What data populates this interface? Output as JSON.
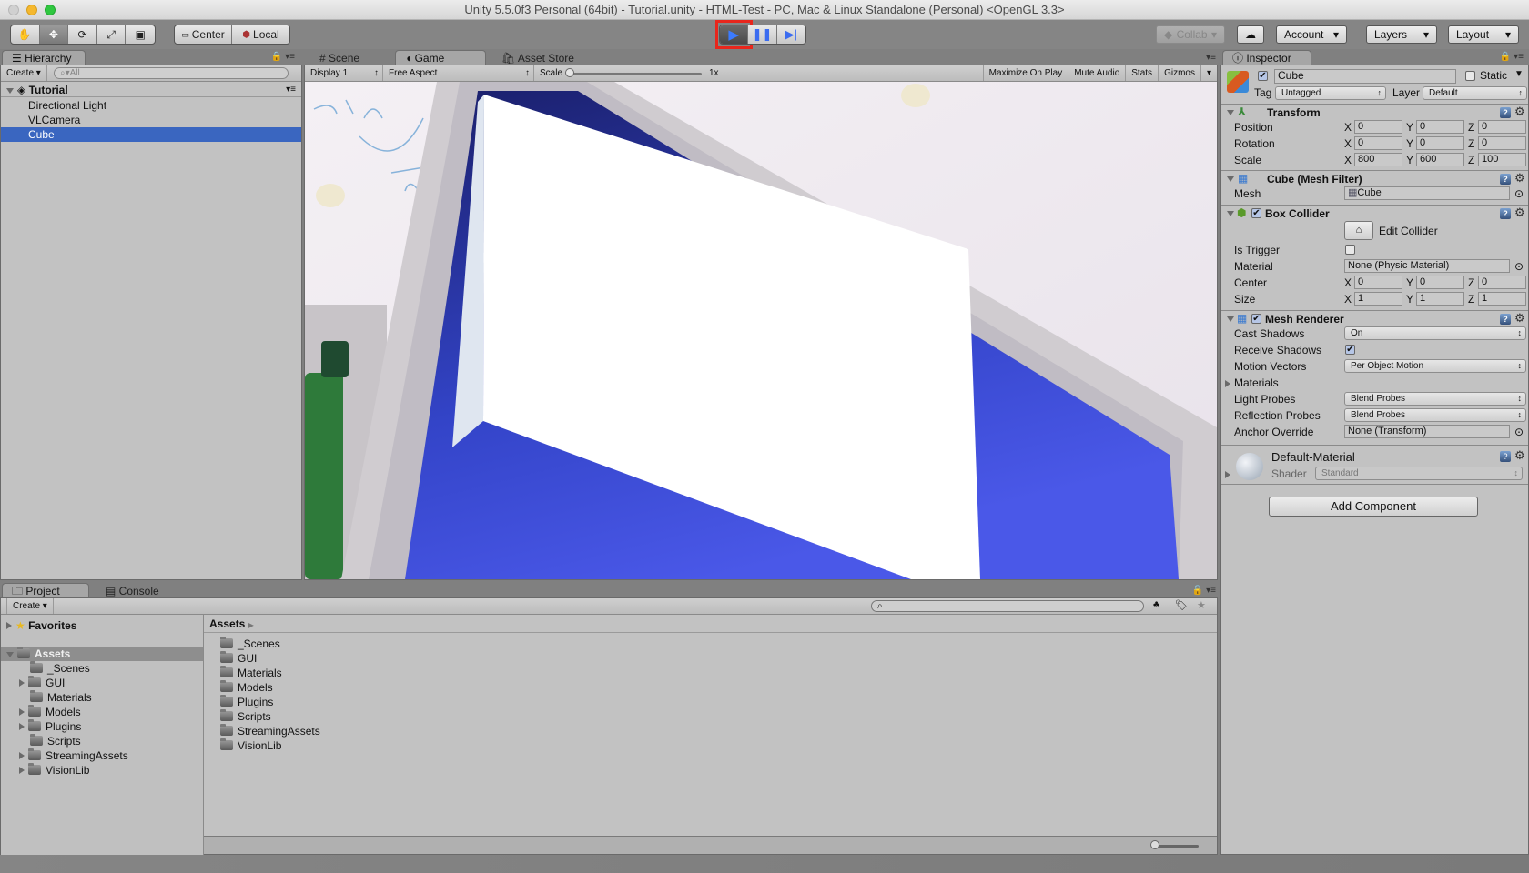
{
  "window": {
    "title": "Unity 5.5.0f3 Personal (64bit) - Tutorial.unity - HTML-Test - PC, Mac & Linux Standalone (Personal) <OpenGL 3.3>"
  },
  "toolbar": {
    "tools": [
      "hand-tool",
      "move-tool",
      "rotate-tool",
      "scale-tool",
      "rect-tool"
    ],
    "pivot_mode": "Center",
    "pivot_rotation": "Local",
    "collab": "Collab",
    "account": "Account",
    "layers": "Layers",
    "layout": "Layout",
    "play_highlight_color": "#e8261c"
  },
  "hierarchy": {
    "tab": "Hierarchy",
    "create": "Create",
    "search_placeholder": "All",
    "scene": "Tutorial",
    "items": [
      {
        "label": "Directional Light",
        "selected": false
      },
      {
        "label": "VLCamera",
        "selected": false
      },
      {
        "label": "Cube",
        "selected": true
      }
    ],
    "selection_color": "#3a66c0"
  },
  "game": {
    "tabs": [
      "Scene",
      "Game",
      "Asset Store"
    ],
    "active_tab": "Game",
    "display": "Display 1",
    "aspect": "Free Aspect",
    "scale_label": "Scale",
    "scale_value": "1x",
    "maximize": "Maximize On Play",
    "mute": "Mute Audio",
    "stats": "Stats",
    "gizmos": "Gizmos"
  },
  "inspector": {
    "tab": "Inspector",
    "object_name": "Cube",
    "active": true,
    "static_label": "Static",
    "tag_label": "Tag",
    "tag": "Untagged",
    "layer_label": "Layer",
    "layer": "Default",
    "transform": {
      "title": "Transform",
      "rows": [
        {
          "label": "Position",
          "x": "0",
          "y": "0",
          "z": "0"
        },
        {
          "label": "Rotation",
          "x": "0",
          "y": "0",
          "z": "0"
        },
        {
          "label": "Scale",
          "x": "800",
          "y": "600",
          "z": "100"
        }
      ]
    },
    "mesh_filter": {
      "title": "Cube (Mesh Filter)",
      "mesh_label": "Mesh",
      "mesh": "Cube"
    },
    "box_collider": {
      "title": "Box Collider",
      "edit": "Edit Collider",
      "is_trigger_label": "Is Trigger",
      "material_label": "Material",
      "material": "None (Physic Material)",
      "center": {
        "label": "Center",
        "x": "0",
        "y": "0",
        "z": "0"
      },
      "size": {
        "label": "Size",
        "x": "1",
        "y": "1",
        "z": "1"
      }
    },
    "mesh_renderer": {
      "title": "Mesh Renderer",
      "cast_shadows_label": "Cast Shadows",
      "cast_shadows": "On",
      "receive_shadows_label": "Receive Shadows",
      "motion_vectors_label": "Motion Vectors",
      "motion_vectors": "Per Object Motion",
      "materials_label": "Materials",
      "light_probes_label": "Light Probes",
      "light_probes": "Blend Probes",
      "reflection_probes_label": "Reflection Probes",
      "reflection_probes": "Blend Probes",
      "anchor_override_label": "Anchor Override",
      "anchor_override": "None (Transform)"
    },
    "material": {
      "name": "Default-Material",
      "shader_label": "Shader",
      "shader": "Standard"
    },
    "add_component": "Add Component"
  },
  "project": {
    "tabs": [
      "Project",
      "Console"
    ],
    "create": "Create",
    "favorites": "Favorites",
    "root": "Assets",
    "tree": [
      {
        "label": "_Scenes",
        "expandable": false
      },
      {
        "label": "GUI",
        "expandable": true
      },
      {
        "label": "Materials",
        "expandable": false
      },
      {
        "label": "Models",
        "expandable": true
      },
      {
        "label": "Plugins",
        "expandable": true
      },
      {
        "label": "Scripts",
        "expandable": false
      },
      {
        "label": "StreamingAssets",
        "expandable": true
      },
      {
        "label": "VisionLib",
        "expandable": true
      }
    ],
    "breadcrumb": "Assets",
    "files": [
      "_Scenes",
      "GUI",
      "Materials",
      "Models",
      "Plugins",
      "Scripts",
      "StreamingAssets",
      "VisionLib"
    ]
  }
}
